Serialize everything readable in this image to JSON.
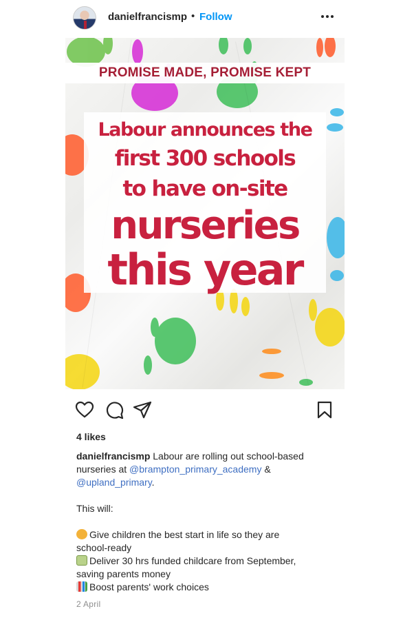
{
  "header": {
    "username": "danielfrancismp",
    "separator": "•",
    "follow_label": "Follow"
  },
  "post_image": {
    "banner": "PROMISE MADE, PROMISE KEPT",
    "headline": [
      "Labour announces the",
      "first 300 schools",
      "to have on-site",
      "nurseries",
      "this year"
    ],
    "colors": {
      "banner_text": "#a51e35",
      "headline_text": "#c8213f"
    }
  },
  "actions": {
    "icons": [
      "heart-icon",
      "comment-icon",
      "share-icon",
      "bookmark-icon"
    ]
  },
  "likes": "4 likes",
  "caption": {
    "username": "danielfrancismp",
    "intro": " Labour are rolling out school-based nurseries at ",
    "mention1": "@brampton_primary_academy",
    "joiner": " &",
    "mention2": "@upland_primary",
    "end": ".",
    "this_will": "This will:",
    "points": [
      {
        "icon": "child-emoji",
        "text": "Give children the best start in life so they are"
      },
      {
        "text": "school-ready"
      },
      {
        "icon": "money-emoji",
        "text": "Deliver 30 hrs funded childcare from September,"
      },
      {
        "text": "saving parents money"
      },
      {
        "icon": "chart-emoji",
        "text": "Boost parents' work choices"
      }
    ]
  },
  "date": "2 April",
  "colors": {
    "link": "#0095f6",
    "mention": "#3f6fc2",
    "muted": "#8e8e8e"
  }
}
